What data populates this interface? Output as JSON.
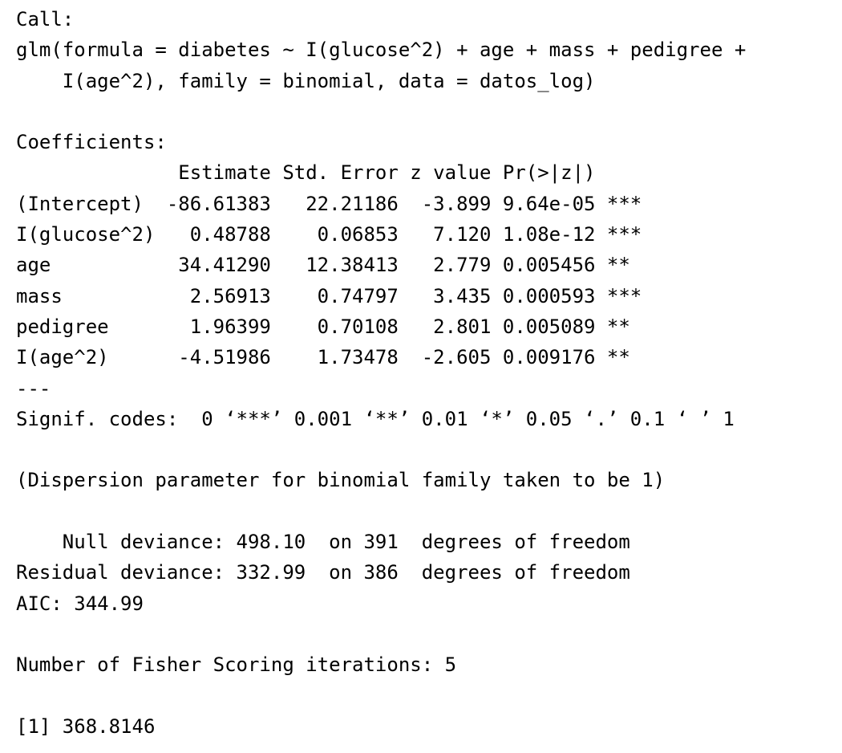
{
  "output": {
    "call_header": "Call:",
    "call_line_1": "glm(formula = diabetes ~ I(glucose^2) + age + mass + pedigree + ",
    "call_line_2": "    I(age^2), family = binomial, data = datos_log)",
    "coef_header": "Coefficients:",
    "coef_table": {
      "header": "              Estimate Std. Error z value Pr(>|z|)    ",
      "rows": [
        "(Intercept)  -86.61383   22.21186  -3.899 9.64e-05 ***",
        "I(glucose^2)   0.48788    0.06853   7.120 1.08e-12 ***",
        "age           34.41290   12.38413   2.779 0.005456 ** ",
        "mass           2.56913    0.74797   3.435 0.000593 ***",
        "pedigree       1.96399    0.70108   2.801 0.005089 ** ",
        "I(age^2)      -4.51986    1.73478  -2.605 0.009176 ** "
      ]
    },
    "separator": "---",
    "signif_codes": "Signif. codes:  0 ‘***’ 0.001 ‘**’ 0.01 ‘*’ 0.05 ‘.’ 0.1 ‘ ’ 1",
    "dispersion": "(Dispersion parameter for binomial family taken to be 1)",
    "null_deviance": "    Null deviance: 498.10  on 391  degrees of freedom",
    "residual_deviance": "Residual deviance: 332.99  on 386  degrees of freedom",
    "aic": "AIC: 344.99",
    "fisher_iterations": "Number of Fisher Scoring iterations: 5",
    "final_result": "[1] 368.8146"
  }
}
